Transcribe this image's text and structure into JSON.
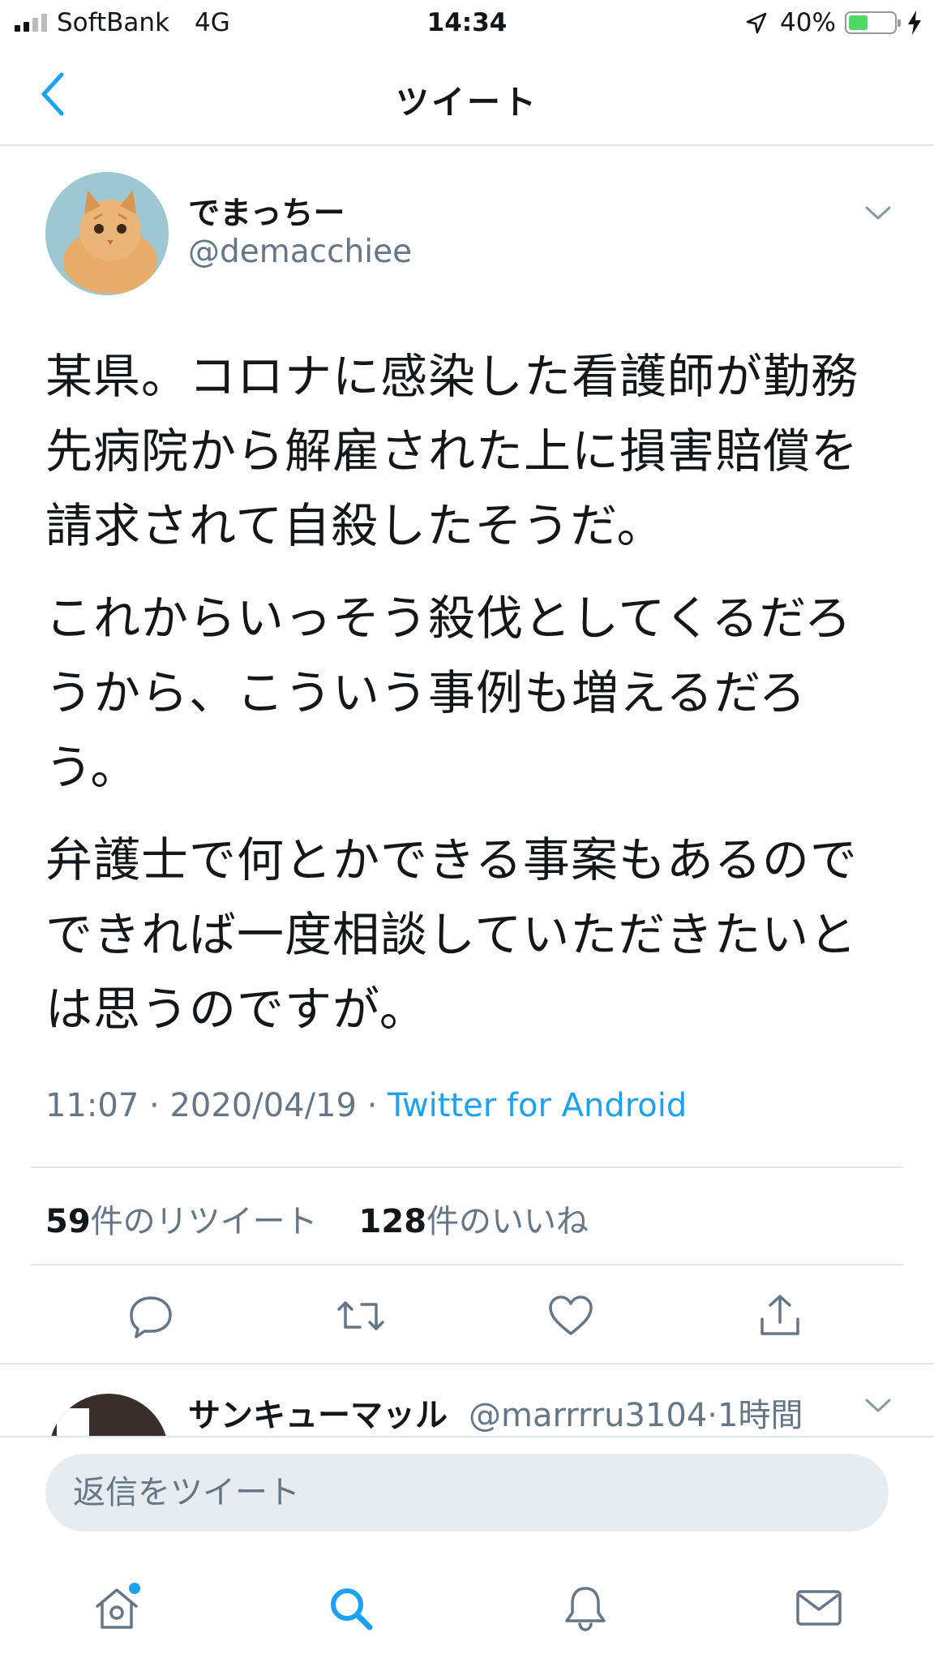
{
  "status_bar": {
    "carrier": "SoftBank",
    "network": "4G",
    "time": "14:34",
    "battery_percent": "40%",
    "battery_level": 0.4,
    "battery_color": "#4cd964"
  },
  "nav": {
    "title": "ツイート",
    "back_icon": "chevron-left-icon"
  },
  "tweet": {
    "author_name": "でまっちー",
    "author_handle": "@demacchiee",
    "paragraphs": [
      "某県。コロナに感染した看護師が勤務先病院から解雇された上に損害賠償を請求されて自殺したそうだ。",
      "これからいっそう殺伐としてくるだろうから、こういう事例も増えるだろう。",
      "弁護士で何とかできる事案もあるのでできれば一度相談していただきたいとは思うのですが。"
    ],
    "time": "11:07",
    "date": "2020/04/19",
    "separator": "·",
    "client": "Twitter for Android",
    "retweet_count": "59",
    "retweet_label": "件のリツイート",
    "like_count": "128",
    "like_label": "件のいいね"
  },
  "actions": [
    "reply-icon",
    "retweet-icon",
    "like-icon",
    "share-icon"
  ],
  "reply_preview": {
    "name": "サンキューマッル",
    "handle": "@marrrru3104",
    "time": "1時間"
  },
  "composer": {
    "placeholder": "返信をツイート"
  },
  "tab_bar": [
    "home-icon",
    "search-icon",
    "notifications-icon",
    "messages-icon"
  ],
  "colors": {
    "accent": "#1da1f2",
    "secondary_text": "#657786",
    "divider": "#e1e8ed"
  }
}
